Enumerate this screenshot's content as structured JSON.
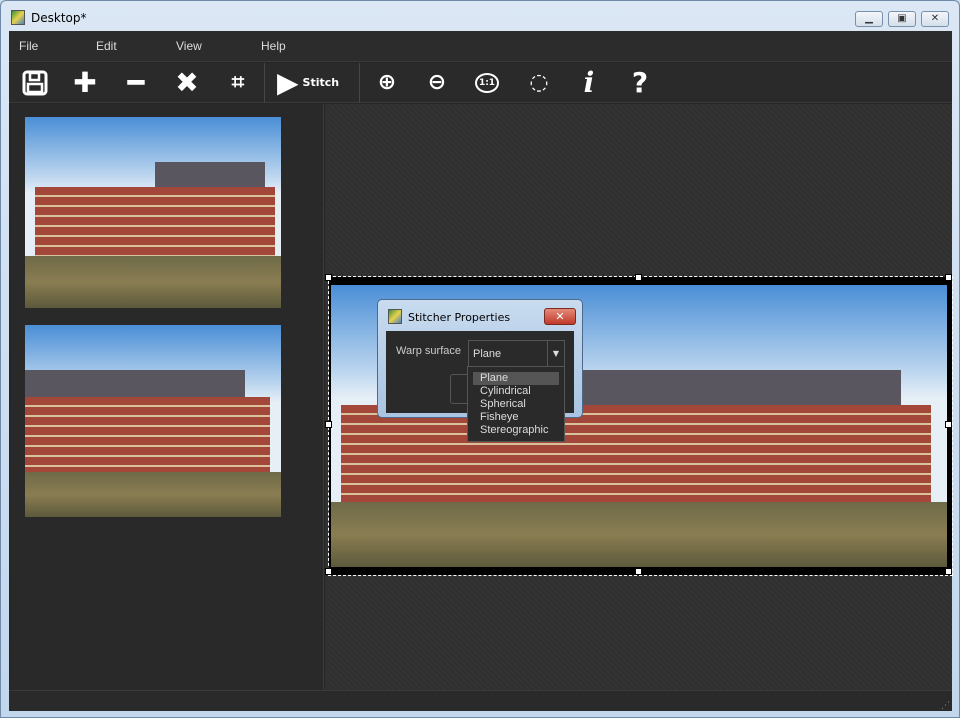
{
  "window": {
    "title": "Desktop*"
  },
  "menu": [
    "File",
    "Edit",
    "View",
    "Help"
  ],
  "toolbar": {
    "save": "save-icon",
    "add": "plus-icon",
    "remove": "minus-icon",
    "delete": "x-icon",
    "crop": "crop-icon",
    "stitch_label": "Stitch",
    "zoom_in": "zoom-in-icon",
    "zoom_out": "zoom-out-icon",
    "zoom_1to1": "1:1",
    "zoom_fit": "zoom-fit-icon",
    "info": "i",
    "help": "?"
  },
  "dialog": {
    "title": "Stitcher Properties",
    "warp_label": "Warp surface",
    "warp_value": "Plane",
    "options": [
      "Plane",
      "Cylindrical",
      "Spherical",
      "Fisheye",
      "Stereographic"
    ],
    "selected": "Plane"
  }
}
